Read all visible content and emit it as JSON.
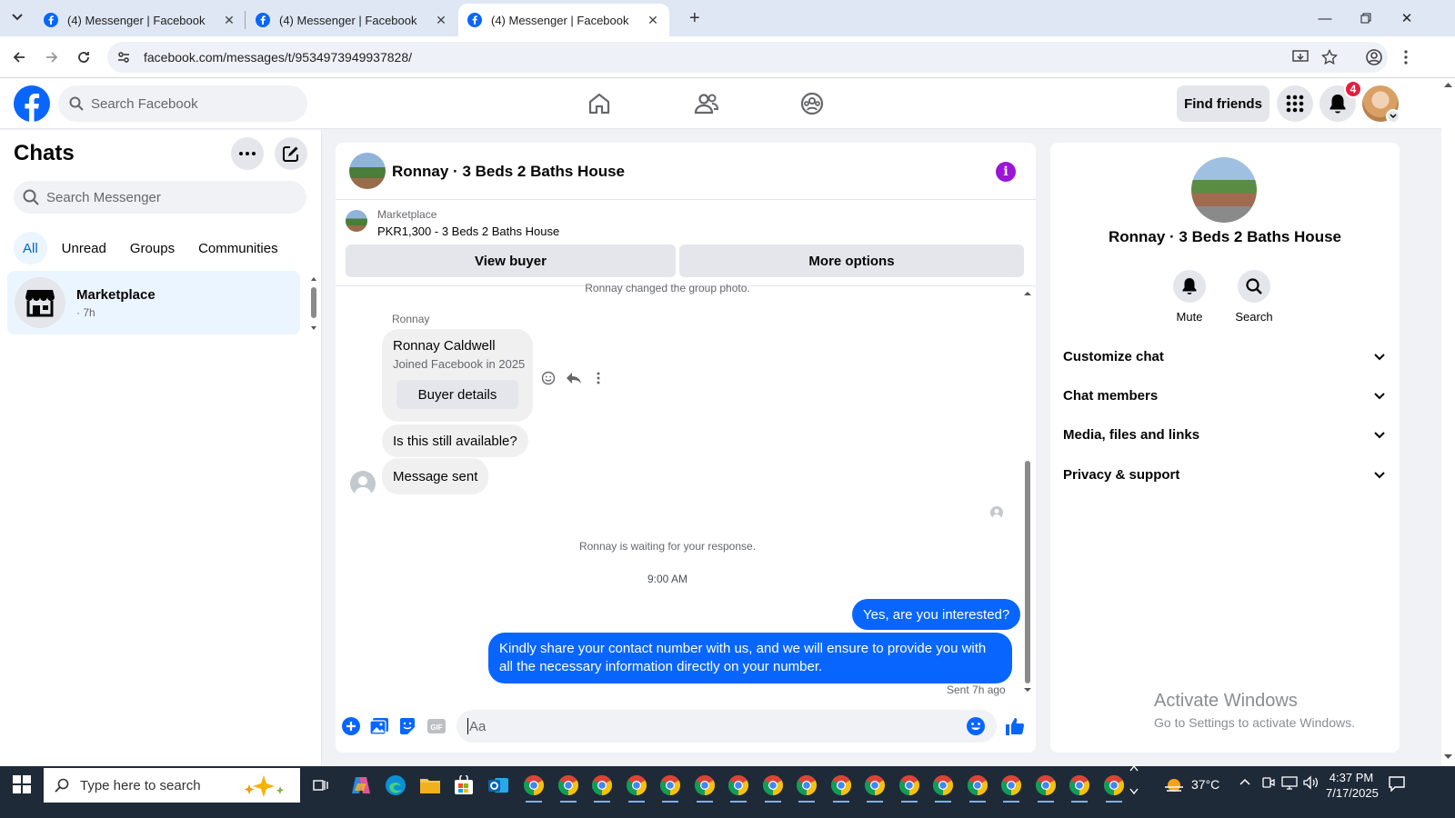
{
  "browser": {
    "tabs": [
      {
        "title": "(4) Messenger | Facebook",
        "active": false
      },
      {
        "title": "(4) Messenger | Facebook",
        "active": false
      },
      {
        "title": "(4) Messenger | Facebook",
        "active": true
      }
    ],
    "url": "facebook.com/messages/t/9534973949937828/"
  },
  "facebook": {
    "search_placeholder": "Search Facebook",
    "find_friends": "Find friends",
    "notifications_count": "4"
  },
  "sidebar": {
    "title": "Chats",
    "search_placeholder": "Search Messenger",
    "filters": [
      "All",
      "Unread",
      "Groups",
      "Communities"
    ],
    "active_filter": "All",
    "chats": [
      {
        "name": "Marketplace",
        "time": "· 7h"
      }
    ]
  },
  "conversation": {
    "title": "Ronnay · 3 Beds 2 Baths House",
    "marketplace_label": "Marketplace",
    "listing": "PKR1,300 - 3 Beds 2 Baths House",
    "view_buyer": "View buyer",
    "more_options": "More options",
    "system_top": "Ronnay changed the group photo.",
    "sender": "Ronnay",
    "card": {
      "name": "Ronnay Caldwell",
      "joined": "Joined Facebook in 2025",
      "button": "Buyer details"
    },
    "incoming": [
      "Is this still available?",
      "Message sent"
    ],
    "waiting": "Ronnay is waiting for your response.",
    "timestamp": "9:00 AM",
    "outgoing": [
      "Yes, are you interested?",
      "Kindly share your contact number with us, and we will ensure to provide you with all the necessary information directly on your number."
    ],
    "sent_status": "Sent 7h ago",
    "composer_placeholder": "Aa"
  },
  "details": {
    "name": "Ronnay · 3 Beds 2 Baths House",
    "actions": [
      "Mute",
      "Search"
    ],
    "sections": [
      "Customize chat",
      "Chat members",
      "Media, files and links",
      "Privacy & support"
    ]
  },
  "watermark": {
    "line1": "Activate Windows",
    "line2": "Go to Settings to activate Windows."
  },
  "taskbar": {
    "search_placeholder": "Type here to search",
    "weather": "37°C",
    "time": "4:37 PM",
    "date": "7/17/2025"
  },
  "colors": {
    "accent": "#0866ff",
    "fb_blue": "#0866ff",
    "selected_bg": "#ebf5ff",
    "info_purple": "#9b15d6"
  }
}
